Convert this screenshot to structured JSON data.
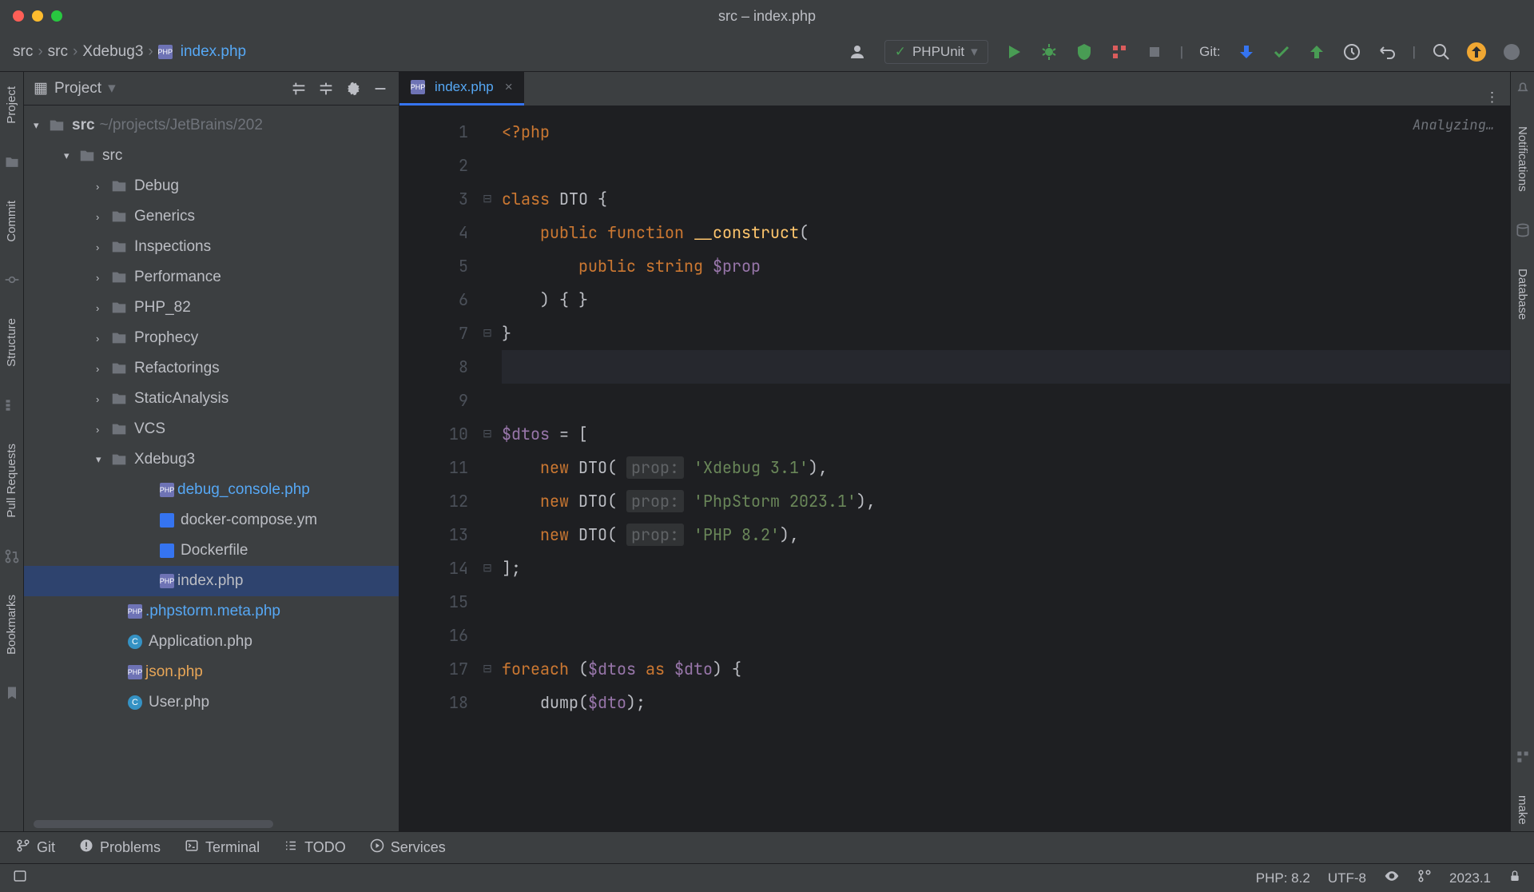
{
  "window": {
    "title": "src – index.php"
  },
  "breadcrumb": {
    "items": [
      "src",
      "src",
      "Xdebug3",
      "index.php"
    ]
  },
  "toolbar": {
    "run_config": "PHPUnit",
    "git_label": "Git:"
  },
  "sidebar": {
    "title": "Project",
    "root": {
      "name": "src",
      "path": "~/projects/JetBrains/202"
    },
    "folders": [
      "src",
      "Debug",
      "Generics",
      "Inspections",
      "Performance",
      "PHP_82",
      "Prophecy",
      "Refactorings",
      "StaticAnalysis",
      "VCS",
      "Xdebug3"
    ],
    "xdebug_files": [
      "debug_console.php",
      "docker-compose.ym",
      "Dockerfile",
      "index.php"
    ],
    "src_files": [
      ".phpstorm.meta.php",
      "Application.php",
      "json.php",
      "User.php"
    ]
  },
  "tab": {
    "name": "index.php"
  },
  "editor": {
    "analyzing": "Analyzing…",
    "lines": {
      "l1_open": "<?php",
      "l3_class": "class",
      "l3_name": "DTO",
      "l3_brace": " {",
      "l4_pub": "public",
      "l4_fn": "function",
      "l4_construct": "__construct",
      "l4_paren": "(",
      "l5_pub": "public",
      "l5_type": "string",
      "l5_var": "$prop",
      "l6": ") { }",
      "l7": "}",
      "l10_var": "$dtos",
      "l10_eq": " = [",
      "l11_new": "new",
      "l11_cls": "DTO",
      "l11_hint": "prop:",
      "l11_str": "'Xdebug 3.1'",
      "l11_end": "),",
      "l12_str": "'PhpStorm 2023.1'",
      "l13_str": "'PHP 8.2'",
      "l14": "];",
      "l17_foreach": "foreach",
      "l17_open": " (",
      "l17_v1": "$dtos",
      "l17_as": " as ",
      "l17_v2": "$dto",
      "l17_close": ") {",
      "l18_fn": "dump",
      "l18_open": "(",
      "l18_v": "$dto",
      "l18_close": ");"
    }
  },
  "bottom": {
    "git": "Git",
    "problems": "Problems",
    "terminal": "Terminal",
    "todo": "TODO",
    "services": "Services"
  },
  "status": {
    "php": "PHP: 8.2",
    "encoding": "UTF-8",
    "version": "2023.1"
  },
  "gutters": {
    "left": [
      "Project",
      "Commit",
      "Structure",
      "Pull Requests",
      "Bookmarks"
    ],
    "right": [
      "Notifications",
      "Database",
      "make"
    ]
  }
}
